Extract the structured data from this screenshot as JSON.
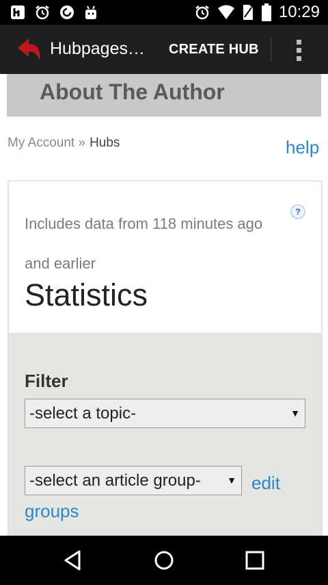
{
  "status_bar": {
    "time": "10:29"
  },
  "app_bar": {
    "title": "Hubpages…",
    "create_label": "CREATE HUB"
  },
  "banner": {
    "text": "About The Author"
  },
  "breadcrumb": {
    "parent": "My Account »",
    "current": "Hubs"
  },
  "help_label": "help",
  "stats": {
    "info_text": "Includes data from 118 minutes ago and earlier",
    "help_symbol": "?",
    "heading": "Statistics"
  },
  "filter": {
    "label": "Filter",
    "topic_select": "-select a topic-",
    "group_select": "-select an article group-",
    "edit_groups": "edit groups"
  },
  "colors": {
    "link": "#2e86c8",
    "app_bar": "#1f1f1f",
    "logo_red": "#c0161d",
    "panel": "#e4e6e1"
  }
}
